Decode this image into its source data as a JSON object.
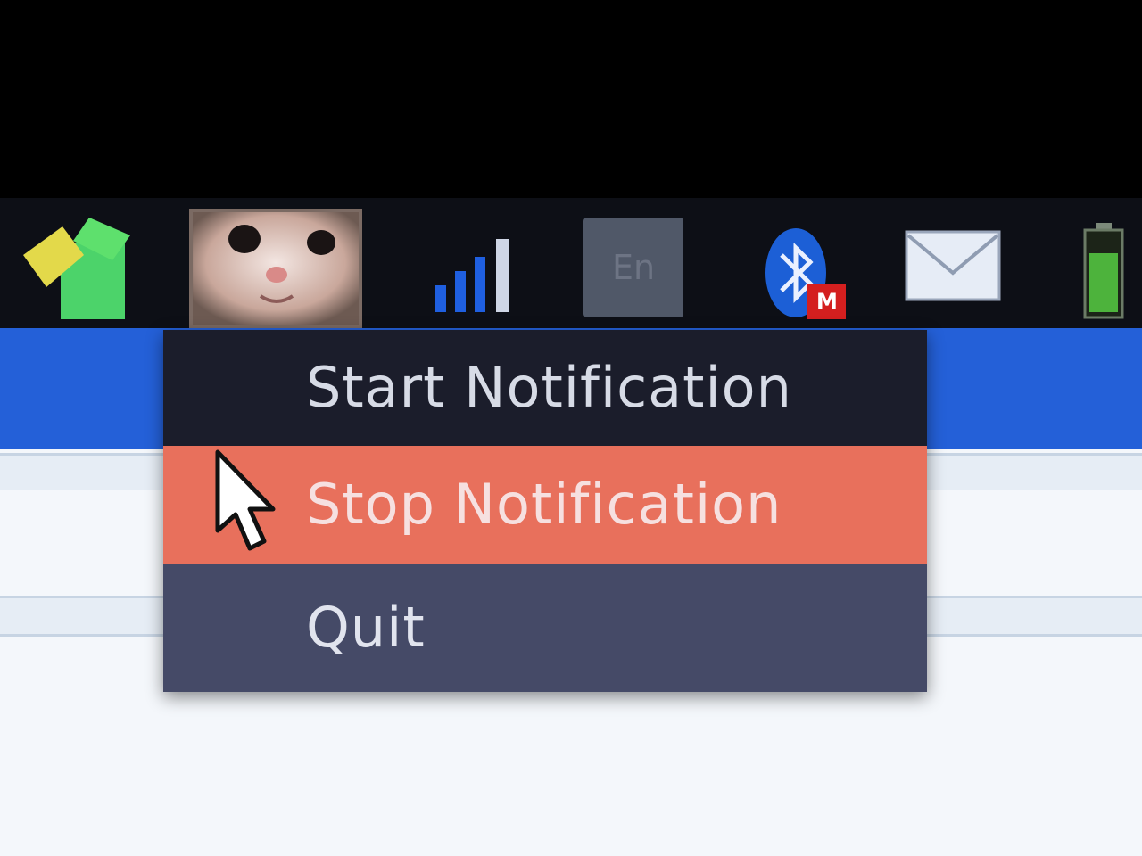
{
  "tray": {
    "icons": [
      {
        "name": "app-launcher-icon"
      },
      {
        "name": "cat-avatar-icon"
      },
      {
        "name": "signal-strength-icon"
      },
      {
        "name": "keyboard-layout-icon",
        "label": "En"
      },
      {
        "name": "bluetooth-icon",
        "badge": "M"
      },
      {
        "name": "mail-icon"
      },
      {
        "name": "battery-icon"
      }
    ]
  },
  "context_menu": {
    "items": [
      {
        "label": "Start Notification",
        "state": "normal"
      },
      {
        "label": "Stop Notification",
        "state": "highlighted"
      },
      {
        "label": "Quit",
        "state": "normal"
      }
    ]
  },
  "colors": {
    "menu_background": "#1b1d2b",
    "highlight": "#e8705c",
    "quit_row": "#454a67",
    "window_titlebar": "#2460d8",
    "panel": "#0d0f16"
  }
}
